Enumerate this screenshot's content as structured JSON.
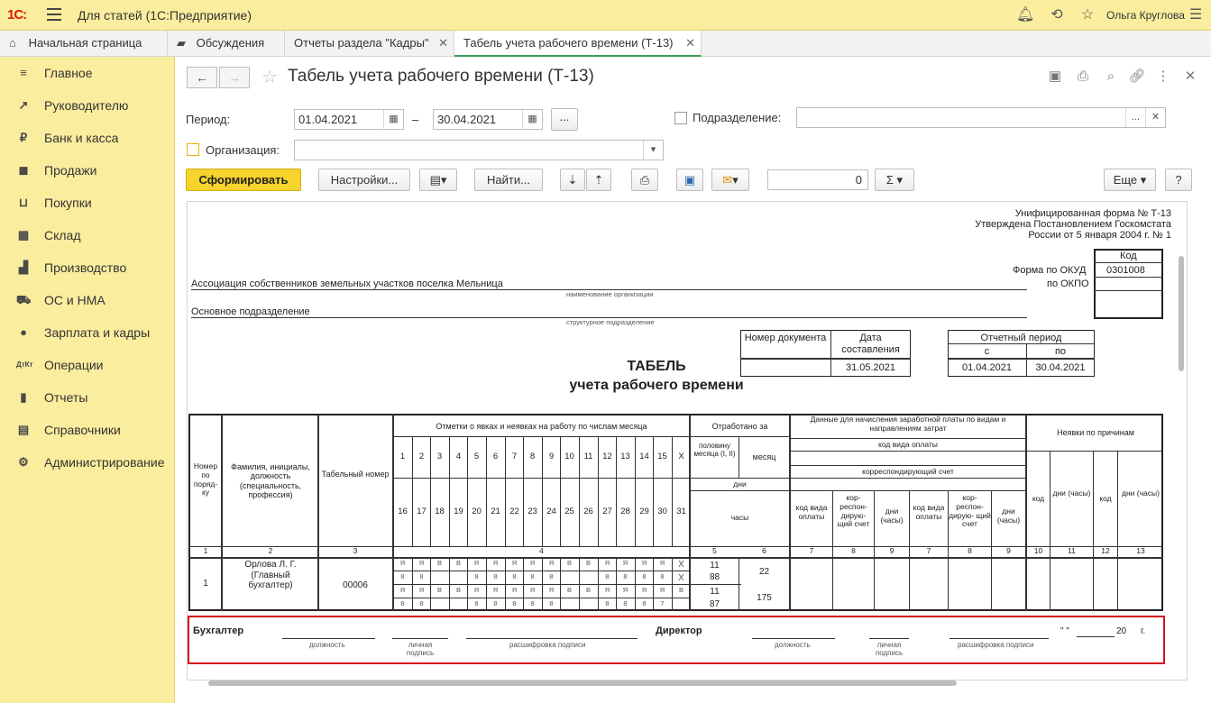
{
  "topbar": {
    "logo": "1С:",
    "app_title": "Для статей  (1С:Предприятие)",
    "user_name": "Ольга Круглова"
  },
  "tabs": [
    {
      "label": "Начальная страница",
      "icon": "home-icon"
    },
    {
      "label": "Обсуждения",
      "icon": "chat-icon"
    },
    {
      "label": "Отчеты раздела \"Кадры\""
    },
    {
      "label": "Табель учета рабочего времени (Т-13)",
      "active": true
    }
  ],
  "sidebar": {
    "items": [
      {
        "label": "Главное",
        "icon": "menu-icon"
      },
      {
        "label": "Руководителю",
        "icon": "trend-icon"
      },
      {
        "label": "Банк и касса",
        "icon": "ruble-icon"
      },
      {
        "label": "Продажи",
        "icon": "bag-icon"
      },
      {
        "label": "Покупки",
        "icon": "cart-icon"
      },
      {
        "label": "Склад",
        "icon": "warehouse-icon"
      },
      {
        "label": "Производство",
        "icon": "factory-icon"
      },
      {
        "label": "ОС и НМА",
        "icon": "truck-icon"
      },
      {
        "label": "Зарплата и кадры",
        "icon": "person-icon"
      },
      {
        "label": "Операции",
        "icon": "dt-kt-icon"
      },
      {
        "label": "Отчеты",
        "icon": "bar-chart-icon"
      },
      {
        "label": "Справочники",
        "icon": "book-icon"
      },
      {
        "label": "Администрирование",
        "icon": "gear-icon"
      }
    ]
  },
  "form": {
    "title": "Табель учета рабочего времени (Т-13)",
    "period_label": "Период:",
    "date_from": "01.04.2021",
    "date_to": "30.04.2021",
    "dash": "–",
    "ellipsis": "...",
    "subdivision_label": "Подразделение:",
    "organization_label": "Организация:",
    "organization_value": "",
    "subdivision_value": ""
  },
  "toolbar": {
    "generate": "Сформировать",
    "settings": "Настройки...",
    "find": "Найти...",
    "sum_value": "0",
    "more": "Еще",
    "help": "?"
  },
  "report": {
    "form_line1": "Унифицированная форма № Т-13",
    "form_line2": "Утверждена Постановлением Госкомстата",
    "form_line3": "России от 5 января 2004 г. № 1",
    "code_header": "Код",
    "okud_label": "Форма по ОКУД",
    "okud_value": "0301008",
    "okpo_label": "по ОКПО",
    "org_name": "Ассоциация собственников земельных участков поселка Мельница",
    "org_caption": "наименование организации",
    "subdivision_name": "Основное подразделение",
    "subdivision_caption": "структурное подразделение",
    "doc_number_header": "Номер документа",
    "doc_date_header": "Дата составления",
    "doc_date": "31.05.2021",
    "period_header": "Отчетный период",
    "period_from_label": "с",
    "period_to_label": "по",
    "period_from": "01.04.2021",
    "period_to": "30.04.2021",
    "title1": "ТАБЕЛЬ",
    "title2": "учета  рабочего времени",
    "col_num": "Номер по поряд- ку",
    "col_name": "Фамилия, инициалы, должность (специальность, профессия)",
    "col_tab": "Табельный номер",
    "col_marks": "Отметки о явках и неявках на работу по числам месяца",
    "col_worked": "Отработано за",
    "col_half": "половину месяца (I, II)",
    "col_month": "месяц",
    "col_days": "дни",
    "col_hours": "часы",
    "col_salary": "Данные для начисления заработной платы по видам и направлениям затрат",
    "col_paycode": "код вида оплаты",
    "col_account": "корреспондирующий счет",
    "col_code_pay": "код вида оплаты",
    "col_corr": "кор- респон- дирую- щий счет",
    "col_daysh": "дни (часы)",
    "col_absence": "Неявки по причинам",
    "col_code": "код",
    "days_row1": [
      "1",
      "2",
      "3",
      "4",
      "5",
      "6",
      "7",
      "8",
      "9",
      "10",
      "11",
      "12",
      "13",
      "14",
      "15",
      "Х"
    ],
    "days_row2": [
      "16",
      "17",
      "18",
      "19",
      "20",
      "21",
      "22",
      "23",
      "24",
      "25",
      "26",
      "27",
      "28",
      "29",
      "30",
      "31"
    ],
    "col_numbers": [
      "1",
      "2",
      "3",
      "4",
      "5",
      "6",
      "7",
      "8",
      "9",
      "7",
      "8",
      "9",
      "10",
      "11",
      "12",
      "13"
    ],
    "employee": {
      "num": "1",
      "name": "Орлова Л. Г. (Главный бухгалтер)",
      "tab": "00006",
      "half1_days": "11",
      "half1_hours": "88",
      "half2_days": "11",
      "half2_hours": "87",
      "month_days": "22",
      "month_hours": "175",
      "row1": [
        "Я",
        "Я",
        "В",
        "В",
        "Я",
        "Я",
        "Я",
        "Я",
        "Я",
        "В",
        "В",
        "Я",
        "Я",
        "Я",
        "Я",
        "Х"
      ],
      "row2": [
        "8",
        "8",
        "",
        "",
        "8",
        "8",
        "8",
        "8",
        "8",
        "",
        "",
        "8",
        "8",
        "8",
        "8",
        "Х"
      ],
      "row3": [
        "Я",
        "Я",
        "В",
        "В",
        "Я",
        "Я",
        "Я",
        "Я",
        "Я",
        "В",
        "В",
        "Я",
        "Я",
        "Я",
        "Я",
        "В"
      ],
      "row4": [
        "8",
        "8",
        "",
        "",
        "8",
        "8",
        "8",
        "8",
        "8",
        "",
        "",
        "8",
        "8",
        "8",
        "7",
        ""
      ]
    },
    "signature": {
      "accountant": "Бухгалтер",
      "director": "Директор",
      "position": "должность",
      "personal_sign": "личная подпись",
      "decoding": "расшифровка подписи",
      "date_prefix": "\" \"",
      "year": "20",
      "year_suffix": "г."
    }
  }
}
